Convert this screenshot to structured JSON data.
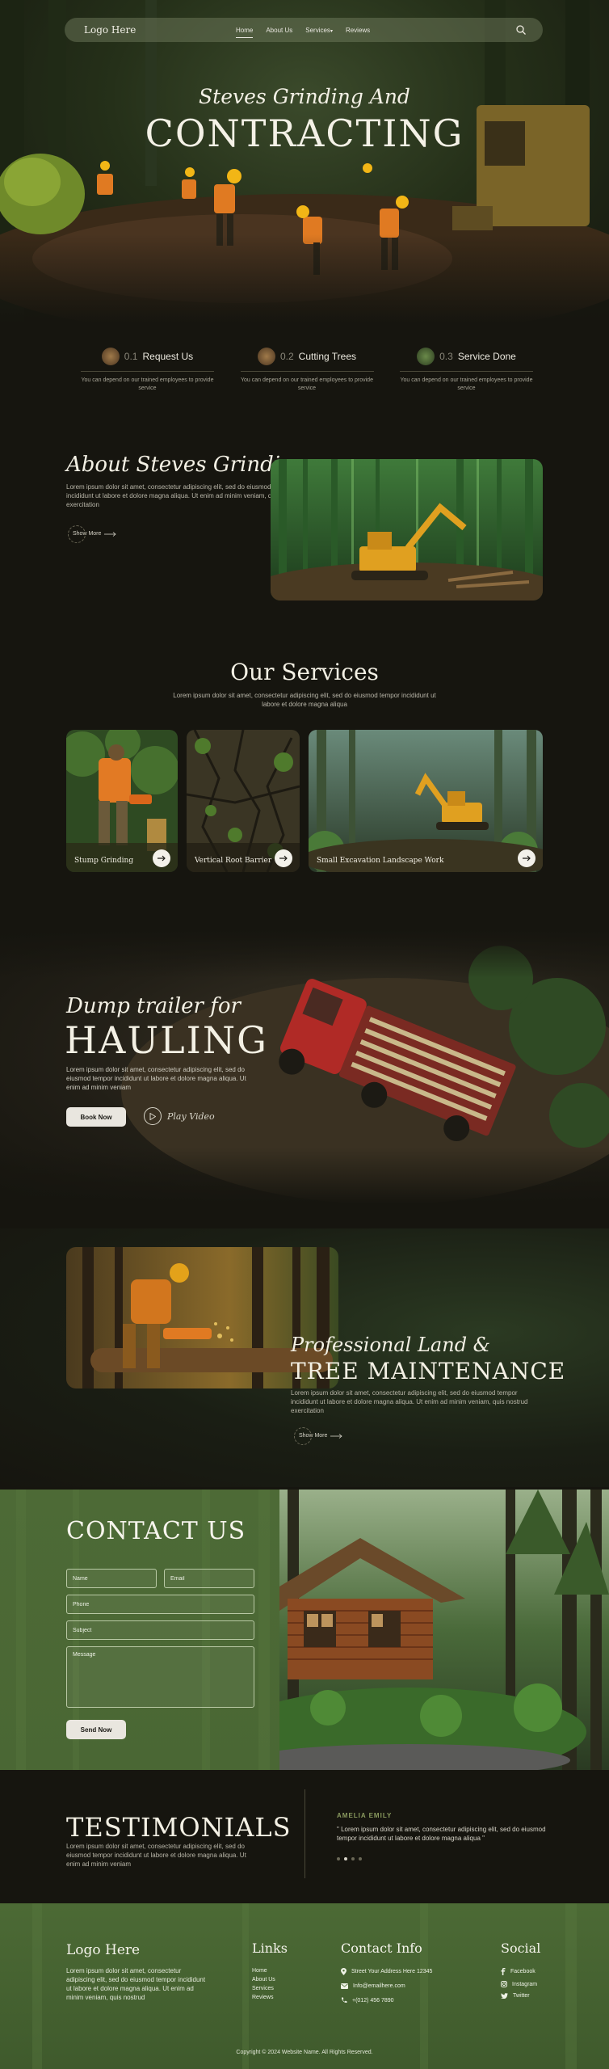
{
  "nav": {
    "logo": "Logo Here",
    "links": [
      "Home",
      "About Us",
      "Services",
      "Reviews"
    ],
    "services_caret": "▾"
  },
  "hero": {
    "subtitle": "Steves Grinding And",
    "title": "CONTRACTING"
  },
  "steps": [
    {
      "num": "0.1",
      "title": "Request Us",
      "desc": "You can depend on our trained employees to provide service"
    },
    {
      "num": "0.2",
      "title": "Cutting Trees",
      "desc": "You can depend on our trained employees to provide service"
    },
    {
      "num": "0.3",
      "title": "Service Done",
      "desc": "You can depend on our trained employees to provide service"
    }
  ],
  "about": {
    "title": "About Steves Grinding",
    "text": "Lorem ipsum dolor sit amet, consectetur adipiscing elit, sed do eiusmod tempor incididunt ut labore et dolore magna aliqua. Ut enim ad minim veniam, quis nostrud exercitation",
    "show_more": "Show More"
  },
  "services": {
    "title": "Our Services",
    "subtitle": "Lorem ipsum dolor sit amet, consectetur adipiscing elit, sed do eiusmod tempor incididunt ut labore et dolore magna aliqua",
    "cards": [
      "Stump Grinding",
      "Vertical Root Barrier",
      "Small Excavation Landscape Work"
    ]
  },
  "hauling": {
    "subtitle": "Dump trailer for",
    "title": "HAULING",
    "text": "Lorem ipsum dolor sit amet, consectetur adipiscing elit, sed do eiusmod tempor incididunt ut labore et dolore magna aliqua. Ut enim ad minim veniam",
    "book_label": "Book Now",
    "play_label": "Play Video"
  },
  "professional": {
    "subtitle": "Professional Land &",
    "title": "TREE MAINTENANCE",
    "text": "Lorem ipsum dolor sit amet, consectetur adipiscing elit, sed do eiusmod tempor incididunt ut labore et dolore magna aliqua. Ut enim ad minim veniam, quis nostrud exercitation",
    "show_more": "Show More"
  },
  "contact": {
    "title": "CONTACT US",
    "name_placeholder": "Name",
    "email_placeholder": "Email",
    "phone_placeholder": "Phone",
    "subject_placeholder": "Subject",
    "message_placeholder": "Message",
    "send_label": "Send Now"
  },
  "testimonials": {
    "title": "TESTIMONIALS",
    "text": "Lorem ipsum dolor sit amet, consectetur adipiscing elit, sed do eiusmod tempor incididunt ut labore et dolore magna aliqua. Ut enim ad minim veniam",
    "name": "AMELIA EMILY",
    "quote": "\" Lorem ipsum dolor sit amet, consectetur adipiscing elit, sed do eiusmod tempor incididunt ut labore et dolore magna aliqua \"",
    "active_dot": 2
  },
  "footer": {
    "logo": "Logo Here",
    "text": "Lorem ipsum dolor sit amet, consectetur adipiscing elit, sed do eiusmod tempor incididunt ut labore et dolore magna aliqua. Ut enim ad minim veniam, quis nostrud",
    "links_title": "Links",
    "links": [
      "Home",
      "About Us",
      "Services",
      "Reviews"
    ],
    "info_title": "Contact Info",
    "address": "Street Your Address Here 12345",
    "email": "Info@emailhere.com",
    "phone": "+(012) 456 7890",
    "social_title": "Social",
    "social": [
      "Facebook",
      "Instagram",
      "Twitter"
    ],
    "copyright": "Copyright © 2024 Website Name. All Rights Reserved."
  },
  "colors": {
    "background": "#16150f",
    "green_panel": "#4c6a35",
    "accent_text": "#8a9a5f",
    "button_light": "#e9e6df"
  },
  "icons": [
    "search-icon",
    "arrow-right-icon",
    "play-icon",
    "location-icon",
    "email-icon",
    "phone-icon",
    "facebook-icon",
    "instagram-icon",
    "twitter-icon"
  ]
}
